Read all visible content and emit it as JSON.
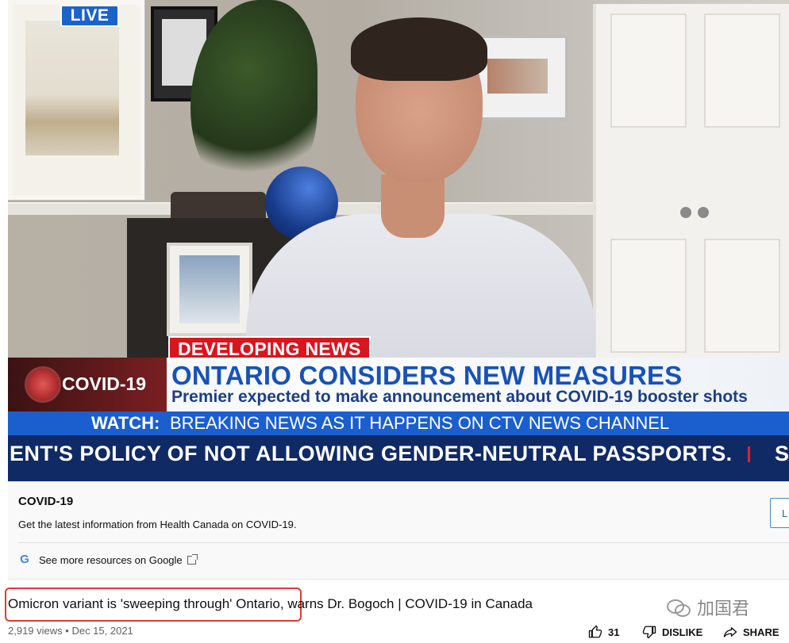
{
  "video": {
    "live_badge": "LIVE",
    "developing_news": "DEVELOPING NEWS",
    "topic_logo": "COVID-19",
    "headline": "ONTARIO CONSIDERS NEW MEASURES",
    "subheadline": "Premier expected to make announcement about COVID-19 booster shots",
    "watch_label": "WATCH:",
    "watch_text": "BREAKING NEWS AS IT HAPPENS ON CTV NEWS CHANNEL",
    "ticker_text": "ENT'S POLICY OF NOT ALLOWING GENDER-NEUTRAL PASSPORTS.",
    "ticker_next": "S"
  },
  "info_panel": {
    "title": "COVID-19",
    "description": "Get the latest information from Health Canada on COVID-19.",
    "more_link": "See more resources on Google",
    "button_label": "L"
  },
  "title": "Omicron variant is 'sweeping through' Ontario, warns Dr. Bogoch | COVID-19 in Canada",
  "watermark": "加国君",
  "meta": {
    "views": "2,919 views",
    "date": "Dec 15, 2021"
  },
  "actions": {
    "likes": "31",
    "dislike": "DISLIKE",
    "share": "SHARE"
  },
  "colors": {
    "live_blue": "#1c63c9",
    "developing_red": "#d9161e",
    "headline_blue": "#1752b8",
    "ticker_navy": "#102a66",
    "highlight_red": "#e53935"
  }
}
